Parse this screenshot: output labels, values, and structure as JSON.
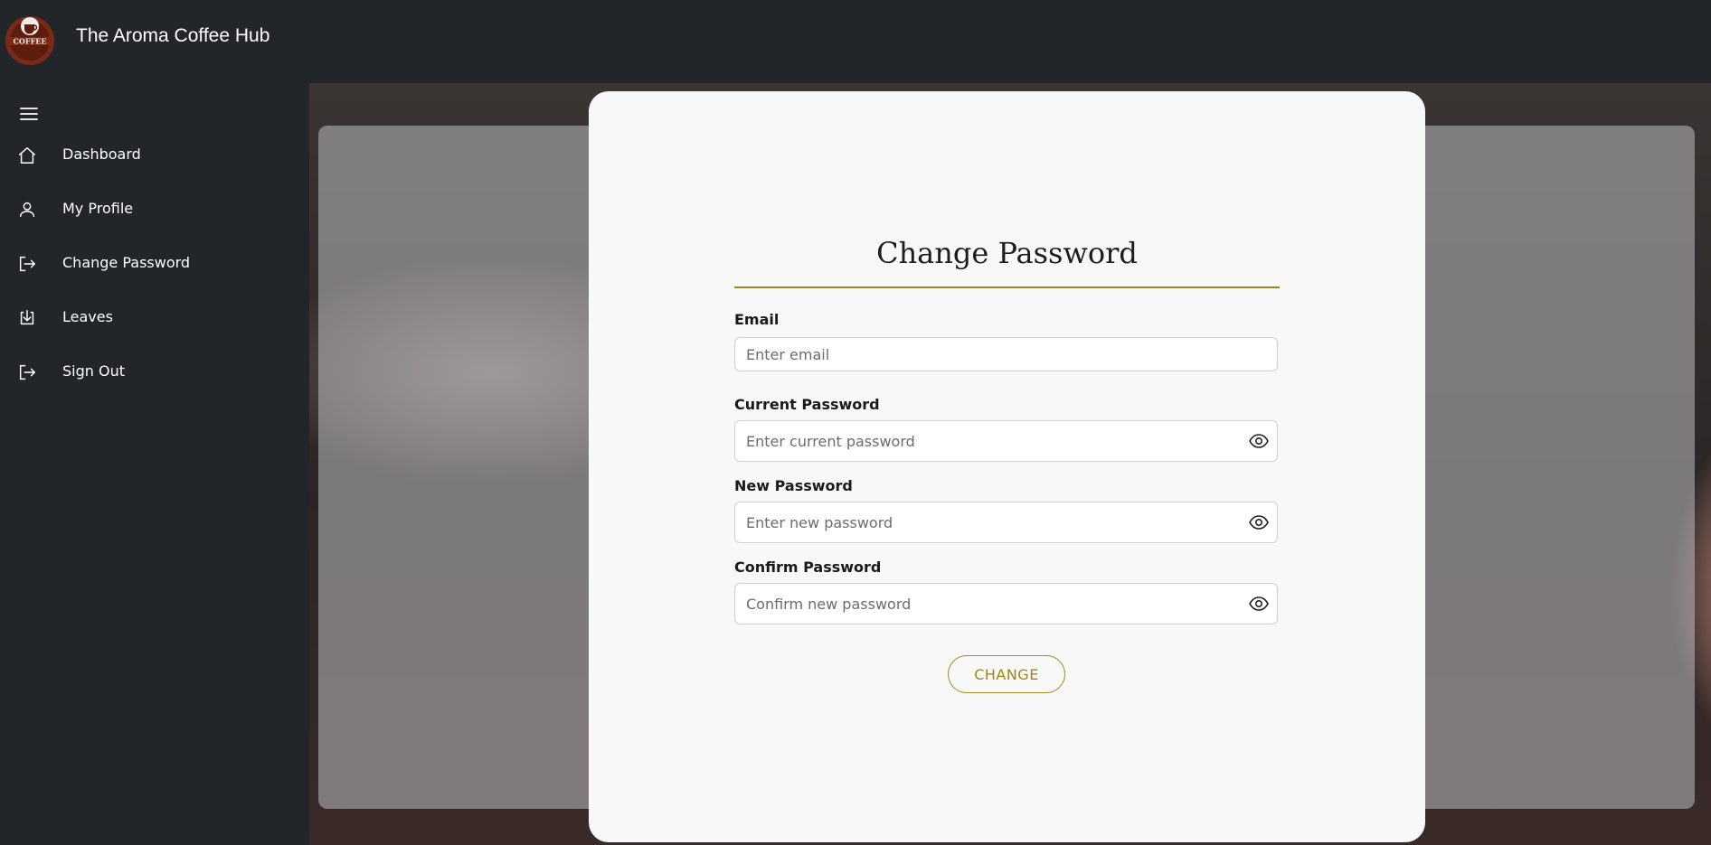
{
  "app": {
    "title": "The Aroma Coffee Hub",
    "logo_text": "COFFEE"
  },
  "sidebar": {
    "items": [
      {
        "label": "Dashboard",
        "icon": "home-icon"
      },
      {
        "label": "My Profile",
        "icon": "user-icon"
      },
      {
        "label": "Change Password",
        "icon": "logout-arrow-icon"
      },
      {
        "label": "Leaves",
        "icon": "download-icon"
      },
      {
        "label": "Sign Out",
        "icon": "logout-arrow-icon"
      }
    ]
  },
  "form": {
    "title": "Change Password",
    "email": {
      "label": "Email",
      "placeholder": "Enter email"
    },
    "current_password": {
      "label": "Current Password",
      "placeholder": "Enter current password"
    },
    "new_password": {
      "label": "New Password",
      "placeholder": "Enter new password"
    },
    "confirm_password": {
      "label": "Confirm Password",
      "placeholder": "Confirm new password"
    },
    "submit_label": "CHANGE"
  },
  "colors": {
    "background": "#22262b",
    "card": "#f8f8f8",
    "accent": "#9c8614",
    "text_light": "#ffffff"
  }
}
